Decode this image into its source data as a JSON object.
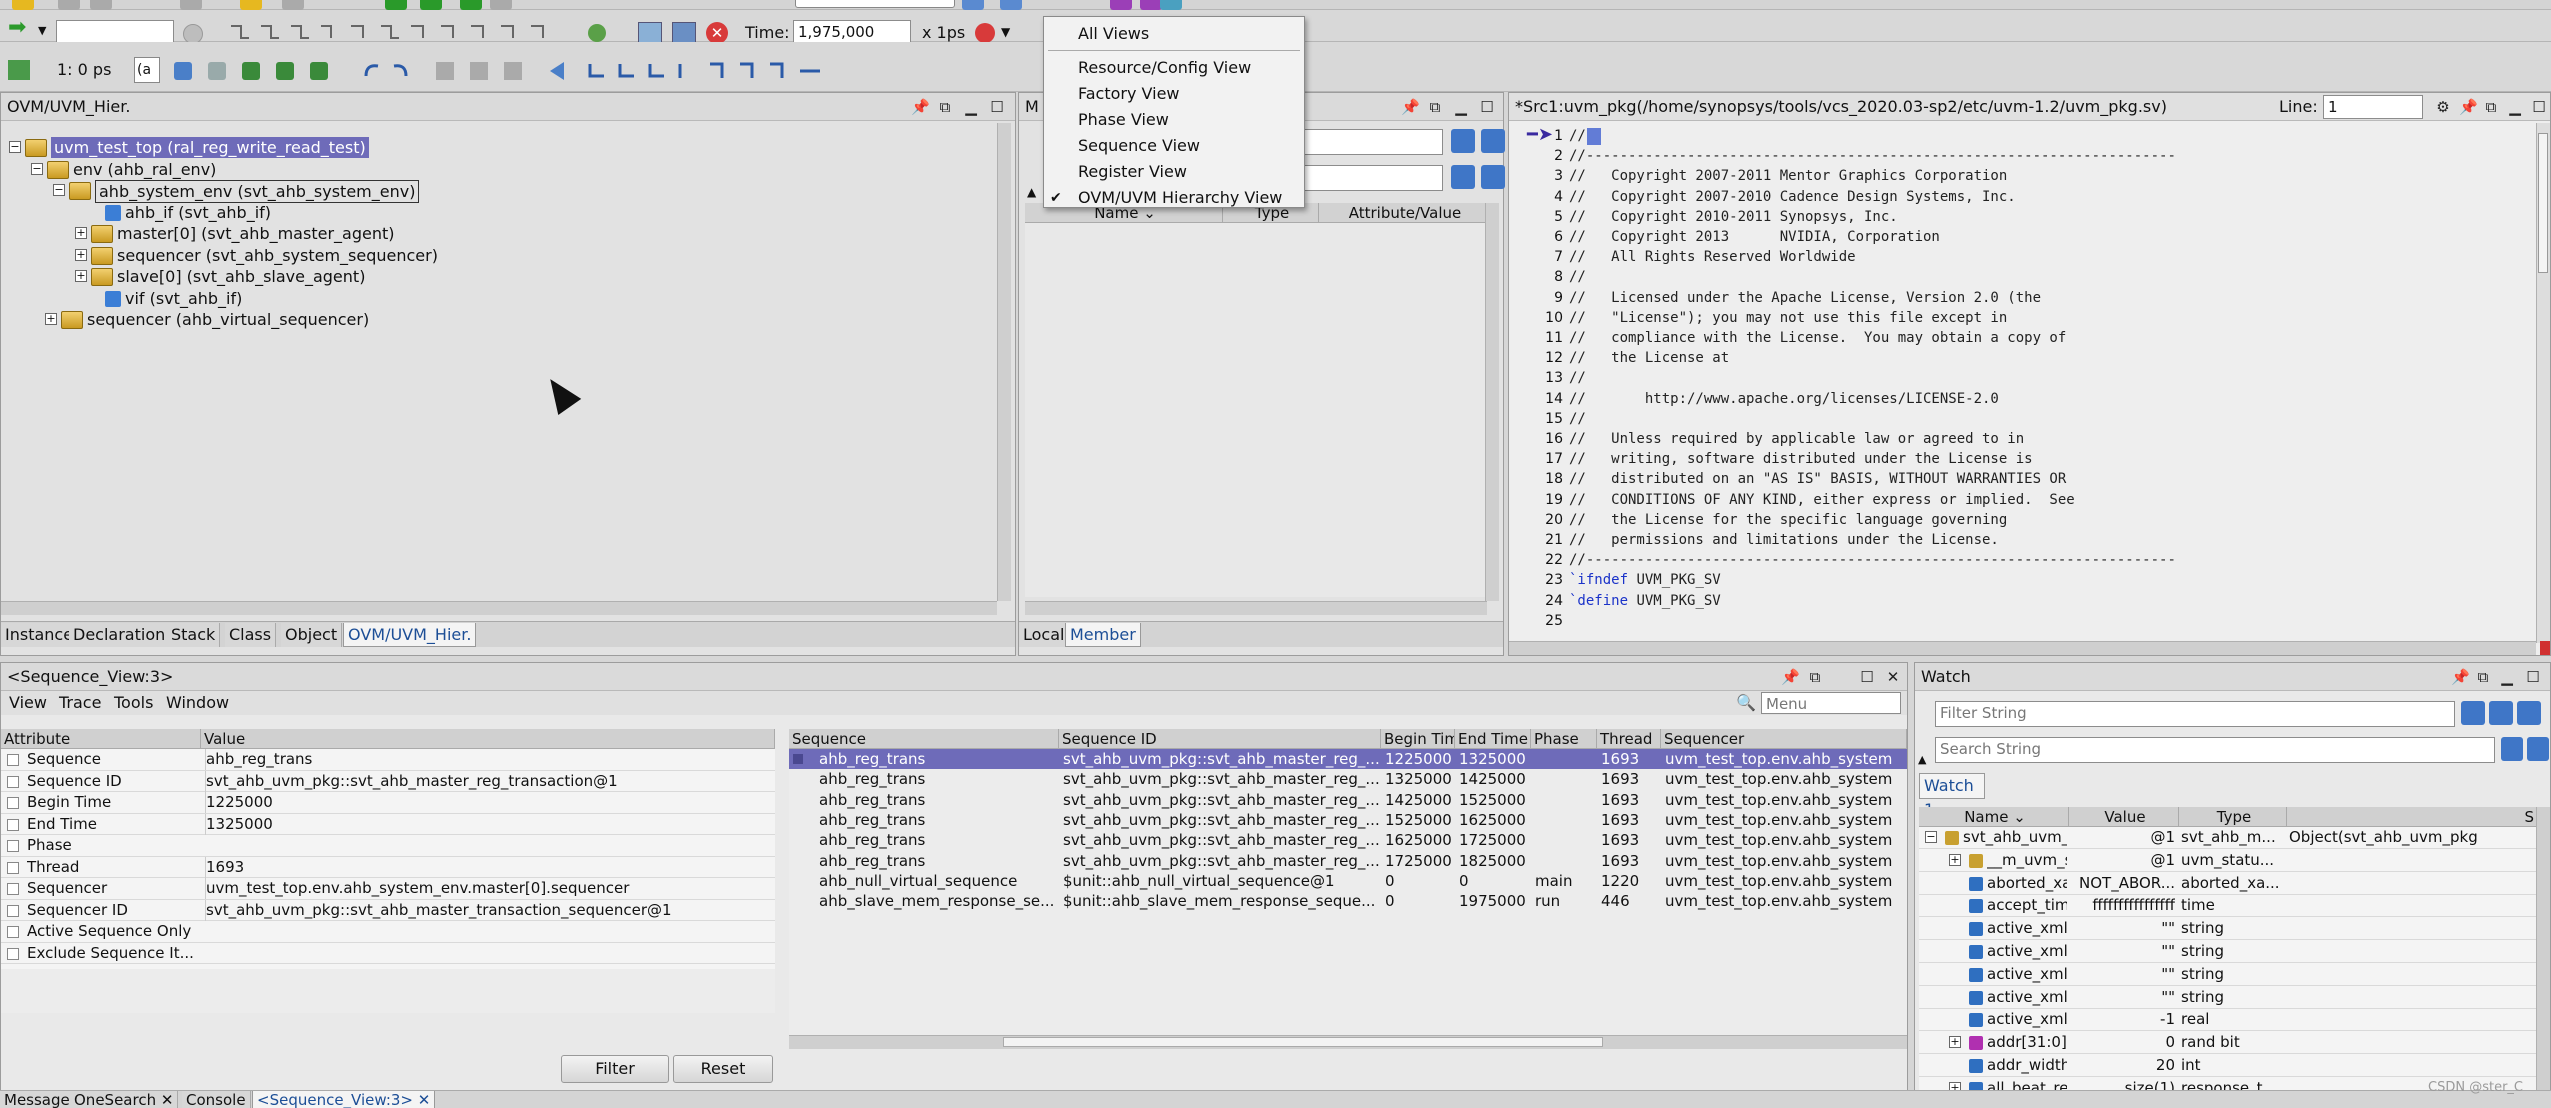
{
  "toolbar": {
    "time_label": "Time:",
    "time_value": "1,975,000",
    "time_unit": "x 1ps",
    "step_combo": "1: 0 ps",
    "step_suffix": "(a"
  },
  "view_menu": {
    "items": [
      {
        "label": "All Views",
        "checked": false
      },
      {
        "label": "Resource/Config View",
        "checked": false
      },
      {
        "label": "Factory View",
        "checked": false
      },
      {
        "label": "Phase View",
        "checked": false
      },
      {
        "label": "Sequence View",
        "checked": false
      },
      {
        "label": "Register View",
        "checked": false
      },
      {
        "label": "OVM/UVM Hierarchy View",
        "checked": true
      }
    ],
    "check_mark": "✔"
  },
  "hier_panel": {
    "title": "OVM/UVM_Hier.",
    "tree": [
      {
        "text": "uvm_test_top (ral_reg_write_read_test)",
        "style": "selected"
      },
      {
        "text": "env (ahb_ral_env)",
        "style": ""
      },
      {
        "text": "ahb_system_env (svt_ahb_system_env)",
        "style": "boxed"
      },
      {
        "text": "ahb_if (svt_ahb_if)",
        "style": ""
      },
      {
        "text": "master[0] (svt_ahb_master_agent)",
        "style": ""
      },
      {
        "text": "sequencer (svt_ahb_system_sequencer)",
        "style": ""
      },
      {
        "text": "slave[0] (svt_ahb_slave_agent)",
        "style": ""
      },
      {
        "text": "vif (svt_ahb_if)",
        "style": ""
      },
      {
        "text": "sequencer (ahb_virtual_sequencer)",
        "style": ""
      }
    ],
    "tabs": [
      "Instance",
      "Declaration",
      "Stack",
      "Class",
      "Object",
      "OVM/UVM_Hier."
    ],
    "active_tab": 5
  },
  "member_panel": {
    "title": "M",
    "columns": [
      "Name",
      "Type",
      "Attribute/Value"
    ],
    "tabs": [
      "Local",
      "Member"
    ],
    "active_tab": 1
  },
  "source_panel": {
    "title": "*Src1:uvm_pkg(/home/synopsys/tools/vcs_2020.03-sp2/etc/uvm-1.2/uvm_pkg.sv)",
    "line_label": "Line:",
    "line_value": "1",
    "lines": [
      {
        "n": "1",
        "text": "//",
        "kw": ""
      },
      {
        "n": "2",
        "text": "//----------------------------------------------------------------------",
        "kw": ""
      },
      {
        "n": "3",
        "text": "//   Copyright 2007-2011 Mentor Graphics Corporation",
        "kw": ""
      },
      {
        "n": "4",
        "text": "//   Copyright 2007-2010 Cadence Design Systems, Inc.",
        "kw": ""
      },
      {
        "n": "5",
        "text": "//   Copyright 2010-2011 Synopsys, Inc.",
        "kw": ""
      },
      {
        "n": "6",
        "text": "//   Copyright 2013      NVIDIA, Corporation",
        "kw": ""
      },
      {
        "n": "7",
        "text": "//   All Rights Reserved Worldwide",
        "kw": ""
      },
      {
        "n": "8",
        "text": "//",
        "kw": ""
      },
      {
        "n": "9",
        "text": "//   Licensed under the Apache License, Version 2.0 (the",
        "kw": ""
      },
      {
        "n": "10",
        "text": "//   \"License\"); you may not use this file except in",
        "kw": ""
      },
      {
        "n": "11",
        "text": "//   compliance with the License.  You may obtain a copy of",
        "kw": ""
      },
      {
        "n": "12",
        "text": "//   the License at",
        "kw": ""
      },
      {
        "n": "13",
        "text": "//",
        "kw": ""
      },
      {
        "n": "14",
        "text": "//       http://www.apache.org/licenses/LICENSE-2.0",
        "kw": ""
      },
      {
        "n": "15",
        "text": "//",
        "kw": ""
      },
      {
        "n": "16",
        "text": "//   Unless required by applicable law or agreed to in",
        "kw": ""
      },
      {
        "n": "17",
        "text": "//   writing, software distributed under the License is",
        "kw": ""
      },
      {
        "n": "18",
        "text": "//   distributed on an \"AS IS\" BASIS, WITHOUT WARRANTIES OR",
        "kw": ""
      },
      {
        "n": "19",
        "text": "//   CONDITIONS OF ANY KIND, either express or implied.  See",
        "kw": ""
      },
      {
        "n": "20",
        "text": "//   the License for the specific language governing",
        "kw": ""
      },
      {
        "n": "21",
        "text": "//   permissions and limitations under the License.",
        "kw": ""
      },
      {
        "n": "22",
        "text": "//----------------------------------------------------------------------",
        "kw": ""
      },
      {
        "n": "23",
        "text": " UVM_PKG_SV",
        "kw": "`ifndef"
      },
      {
        "n": "24",
        "text": " UVM_PKG_SV",
        "kw": "`define"
      },
      {
        "n": "25",
        "text": "",
        "kw": ""
      }
    ]
  },
  "seq_panel": {
    "title": "<Sequence_View:3>",
    "menus": [
      "View",
      "Trace",
      "Tools",
      "Window"
    ],
    "search_placeholder": "Menu",
    "attr_columns": [
      "Attribute",
      "Value"
    ],
    "attributes": [
      {
        "name": "Sequence",
        "value": "ahb_reg_trans"
      },
      {
        "name": "Sequence ID",
        "value": "svt_ahb_uvm_pkg::svt_ahb_master_reg_transaction@1"
      },
      {
        "name": "Begin Time",
        "value": "1225000"
      },
      {
        "name": "End Time",
        "value": "1325000"
      },
      {
        "name": "Phase",
        "value": ""
      },
      {
        "name": "Thread",
        "value": "1693"
      },
      {
        "name": "Sequencer",
        "value": "uvm_test_top.env.ahb_system_env.master[0].sequencer"
      },
      {
        "name": "Sequencer ID",
        "value": "svt_ahb_uvm_pkg::svt_ahb_master_transaction_sequencer@1"
      },
      {
        "name": "Active Sequence Only",
        "value": ""
      },
      {
        "name": "Exclude Sequence It...",
        "value": ""
      }
    ],
    "filter_btn": "Filter",
    "reset_btn": "Reset",
    "seq_columns": [
      "Sequence",
      "Sequence ID",
      "Begin Tim",
      "End Time",
      "Phase",
      "Thread",
      "Sequencer"
    ],
    "sequences": [
      {
        "seq": "ahb_reg_trans",
        "id": "svt_ahb_uvm_pkg::svt_ahb_master_reg_...",
        "begin": "1225000",
        "end": "1325000",
        "phase": "",
        "thread": "1693",
        "sqr": "uvm_test_top.env.ahb_system",
        "sel": true
      },
      {
        "seq": "ahb_reg_trans",
        "id": "svt_ahb_uvm_pkg::svt_ahb_master_reg_...",
        "begin": "1325000",
        "end": "1425000",
        "phase": "",
        "thread": "1693",
        "sqr": "uvm_test_top.env.ahb_system",
        "sel": false
      },
      {
        "seq": "ahb_reg_trans",
        "id": "svt_ahb_uvm_pkg::svt_ahb_master_reg_...",
        "begin": "1425000",
        "end": "1525000",
        "phase": "",
        "thread": "1693",
        "sqr": "uvm_test_top.env.ahb_system",
        "sel": false
      },
      {
        "seq": "ahb_reg_trans",
        "id": "svt_ahb_uvm_pkg::svt_ahb_master_reg_...",
        "begin": "1525000",
        "end": "1625000",
        "phase": "",
        "thread": "1693",
        "sqr": "uvm_test_top.env.ahb_system",
        "sel": false
      },
      {
        "seq": "ahb_reg_trans",
        "id": "svt_ahb_uvm_pkg::svt_ahb_master_reg_...",
        "begin": "1625000",
        "end": "1725000",
        "phase": "",
        "thread": "1693",
        "sqr": "uvm_test_top.env.ahb_system",
        "sel": false
      },
      {
        "seq": "ahb_reg_trans",
        "id": "svt_ahb_uvm_pkg::svt_ahb_master_reg_...",
        "begin": "1725000",
        "end": "1825000",
        "phase": "",
        "thread": "1693",
        "sqr": "uvm_test_top.env.ahb_system",
        "sel": false
      },
      {
        "seq": "ahb_null_virtual_sequence",
        "id": "$unit::ahb_null_virtual_sequence@1",
        "begin": "0",
        "end": "0",
        "phase": "main",
        "thread": "1220",
        "sqr": "uvm_test_top.env.ahb_system",
        "sel": false
      },
      {
        "seq": "ahb_slave_mem_response_se...",
        "id": "$unit::ahb_slave_mem_response_seque...",
        "begin": "0",
        "end": "1975000",
        "phase": "run",
        "thread": "446",
        "sqr": "uvm_test_top.env.ahb_system",
        "sel": false
      }
    ]
  },
  "watch_panel": {
    "title": "Watch",
    "filter_placeholder": "Filter String",
    "search_placeholder": "Search String",
    "tab": "Watch 1",
    "columns": [
      "Name",
      "Value",
      "Type",
      "S"
    ],
    "rows": [
      {
        "name": "svt_ahb_uvm_p...",
        "value": "@1",
        "type": "svt_ahb_m...",
        "extra": "Object(svt_ahb_uvm_pkg",
        "exp": "minus",
        "indent": 0,
        "color": "#c8a030"
      },
      {
        "name": "__m_uvm_st...",
        "value": "@1",
        "type": "uvm_statu...",
        "extra": "",
        "exp": "plus",
        "indent": 1,
        "color": "#c8a030"
      },
      {
        "name": "aborted_xac...",
        "value": "NOT_ABOR...",
        "type": "aborted_xa...",
        "extra": "",
        "exp": "",
        "indent": 1,
        "color": "#2f6fc0"
      },
      {
        "name": "accept_time",
        "value": "ffffffffffffffff",
        "type": "time",
        "extra": "",
        "exp": "",
        "indent": 1,
        "color": "#2f6fc0"
      },
      {
        "name": "active_xml_c...",
        "value": "\"\"",
        "type": "string",
        "extra": "",
        "exp": "",
        "indent": 1,
        "color": "#2f6fc0"
      },
      {
        "name": "active_xml_...",
        "value": "\"\"",
        "type": "string",
        "extra": "",
        "exp": "",
        "indent": 1,
        "color": "#2f6fc0"
      },
      {
        "name": "active_xml_...",
        "value": "\"\"",
        "type": "string",
        "extra": "",
        "exp": "",
        "indent": 1,
        "color": "#2f6fc0"
      },
      {
        "name": "active_xml_...",
        "value": "\"\"",
        "type": "string",
        "extra": "",
        "exp": "",
        "indent": 1,
        "color": "#2f6fc0"
      },
      {
        "name": "active_xml_s...",
        "value": "-1",
        "type": "real",
        "extra": "",
        "exp": "",
        "indent": 1,
        "color": "#2f6fc0"
      },
      {
        "name": "addr[31:0]",
        "value": "0",
        "type": "rand bit",
        "extra": "",
        "exp": "plus",
        "indent": 1,
        "color": "#b030b0"
      },
      {
        "name": "addr_width",
        "value": "20",
        "type": "int",
        "extra": "",
        "exp": "",
        "indent": 1,
        "color": "#2f6fc0"
      },
      {
        "name": "all_beat_res...",
        "value": "size(1)",
        "type": "response_t...",
        "extra": "",
        "exp": "plus",
        "indent": 1,
        "color": "#2f6fc0"
      }
    ]
  },
  "bottom_tabs": [
    "Message",
    "OneSearch",
    "Console",
    "<Sequence_View:3>"
  ],
  "watermark": "CSDN @ster_C"
}
